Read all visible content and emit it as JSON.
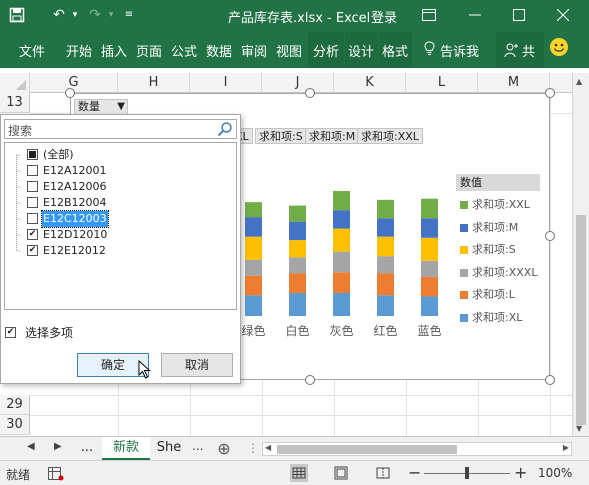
{
  "window": {
    "title": "产品库存表.xlsx - Excel",
    "login": "登录",
    "accent": "#217346"
  },
  "ribbon": {
    "tabs": [
      "文件",
      "开始",
      "插入",
      "页面",
      "公式",
      "数据",
      "审阅",
      "视图",
      "分析",
      "设计",
      "格式"
    ],
    "tell_me": "告诉我",
    "share": "共"
  },
  "grid": {
    "columns": [
      "G",
      "H",
      "I",
      "J",
      "K",
      "L",
      "M"
    ],
    "rows": [
      "13",
      "29",
      "30"
    ]
  },
  "chart": {
    "field_button": "数量",
    "series_buttons": [
      "XL",
      "求和项:S",
      "求和项:M",
      "求和项:XXL"
    ],
    "legend_title": "数值",
    "legend": [
      {
        "label": "求和项:XXL",
        "color": "#70ad47"
      },
      {
        "label": "求和项:M",
        "color": "#4472c4"
      },
      {
        "label": "求和项:S",
        "color": "#ffc000"
      },
      {
        "label": "求和项:XXXL",
        "color": "#a5a5a5"
      },
      {
        "label": "求和项:L",
        "color": "#ed7d31"
      },
      {
        "label": "求和项:XL",
        "color": "#5b9bd5"
      }
    ],
    "categories": [
      "绿色",
      "白色",
      "灰色",
      "红色",
      "蓝色"
    ]
  },
  "chart_data": {
    "type": "bar",
    "stacked": true,
    "categories": [
      "绿色",
      "白色",
      "灰色",
      "红色",
      "蓝色"
    ],
    "series": [
      {
        "name": "求和项:XL",
        "values": [
          18,
          20,
          20,
          18,
          17
        ]
      },
      {
        "name": "求和项:L",
        "values": [
          17,
          17,
          18,
          19,
          17
        ]
      },
      {
        "name": "求和项:XXXL",
        "values": [
          14,
          14,
          18,
          15,
          14
        ]
      },
      {
        "name": "求和项:S",
        "values": [
          20,
          15,
          20,
          17,
          20
        ]
      },
      {
        "name": "求和项:M",
        "values": [
          17,
          16,
          16,
          16,
          17
        ]
      },
      {
        "name": "求和项:XXL",
        "values": [
          13,
          14,
          18,
          16,
          17
        ]
      }
    ]
  },
  "filter_panel": {
    "search_placeholder": "搜索",
    "items": [
      {
        "label": "(全部)",
        "state": "partial"
      },
      {
        "label": "E12A12001",
        "state": "unchecked"
      },
      {
        "label": "E12A12006",
        "state": "unchecked"
      },
      {
        "label": "E12B12004",
        "state": "unchecked"
      },
      {
        "label": "E12C12003",
        "state": "unchecked",
        "selected": true
      },
      {
        "label": "E12D12010",
        "state": "checked"
      },
      {
        "label": "E12E12012",
        "state": "checked"
      }
    ],
    "multi_select_label": "选择多项",
    "ok": "确定",
    "cancel": "取消"
  },
  "sheet_tabs": {
    "ellipsis_left": "...",
    "tabs": [
      "新款",
      "She"
    ],
    "ellipsis_right": "..."
  },
  "status": {
    "ready": "就绪",
    "zoom": "100%"
  }
}
